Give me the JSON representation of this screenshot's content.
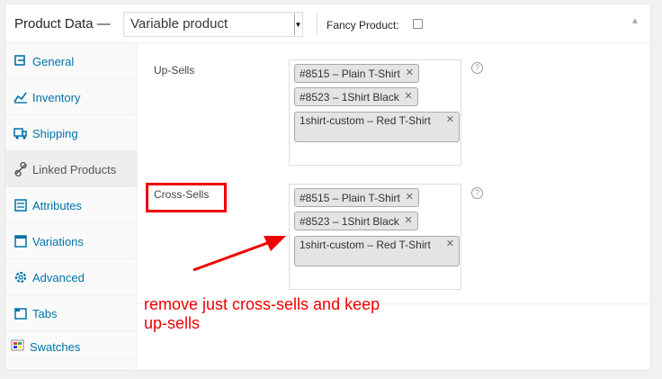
{
  "header": {
    "title": "Product Data —",
    "product_type": "Variable product",
    "fancy_product_label": "Fancy Product:"
  },
  "tabs": [
    {
      "label": "General",
      "icon": "wrench-icon"
    },
    {
      "label": "Inventory",
      "icon": "chart-icon"
    },
    {
      "label": "Shipping",
      "icon": "truck-icon"
    },
    {
      "label": "Linked Products",
      "icon": "link-icon"
    },
    {
      "label": "Attributes",
      "icon": "list-icon"
    },
    {
      "label": "Variations",
      "icon": "grid-icon"
    },
    {
      "label": "Advanced",
      "icon": "gear-icon"
    },
    {
      "label": "Tabs",
      "icon": "tabs-icon"
    },
    {
      "label": "Swatches",
      "icon": "swatches-icon"
    }
  ],
  "upsells": {
    "label": "Up-Sells",
    "items": [
      "#8515 – Plain T-Shirt",
      "#8523 – 1Shirt Black",
      "1shirt-custom – Red T-Shirt"
    ]
  },
  "crosssells": {
    "label": "Cross-Sells",
    "items": [
      "#8515 – Plain T-Shirt",
      "#8523 – 1Shirt Black",
      "1shirt-custom – Red T-Shirt"
    ]
  },
  "annotation": {
    "line1": "remove just cross-sells and keep",
    "line2": "up-sells"
  },
  "colors": {
    "link": "#0073aa",
    "annotation": "#e00000"
  }
}
